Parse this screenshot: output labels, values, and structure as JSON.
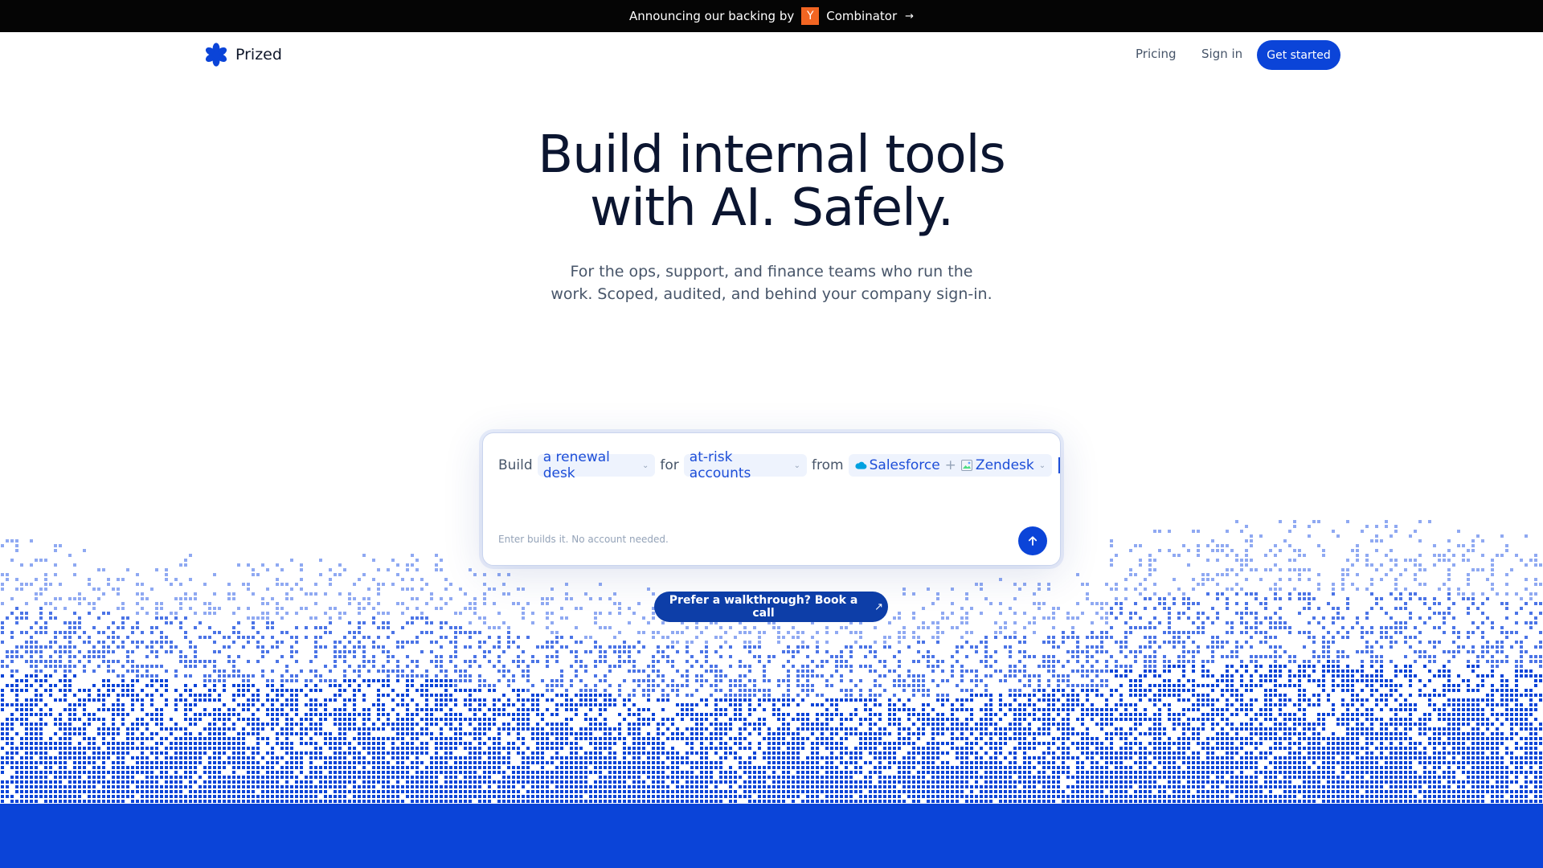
{
  "announcement": {
    "prefix": "Announcing our backing by",
    "badge": "Y",
    "name": "Combinator",
    "arrow": "→"
  },
  "nav": {
    "brand": "Prized",
    "logo_icon": "asterisk-flower-icon",
    "links": [
      "Pricing",
      "Sign in"
    ],
    "cta": "Get started"
  },
  "hero": {
    "title_line1": "Build internal tools",
    "title_line2": "with AI. Safely.",
    "subtitle_line1": "For the ops, support, and finance teams who run the",
    "subtitle_line2": "work. Scoped, audited, and behind your company sign-in."
  },
  "prompt": {
    "word_build": "Build",
    "chip_what": "a renewal desk",
    "word_for": "for",
    "chip_who": "at-risk accounts",
    "word_from": "from",
    "source_1": "Salesforce",
    "plus": "+",
    "source_2": "Zendesk",
    "hint": "Enter builds it. No account needed.",
    "submit_icon": "arrow-up-icon"
  },
  "walkthrough": {
    "label": "Prefer a walkthrough? Book a call",
    "arrow": "↗"
  },
  "colors": {
    "brand_blue": "#0b44d8",
    "deep_blue": "#0d3ea8",
    "chip_bg": "#eef3fd",
    "yc_orange": "#f26522"
  }
}
